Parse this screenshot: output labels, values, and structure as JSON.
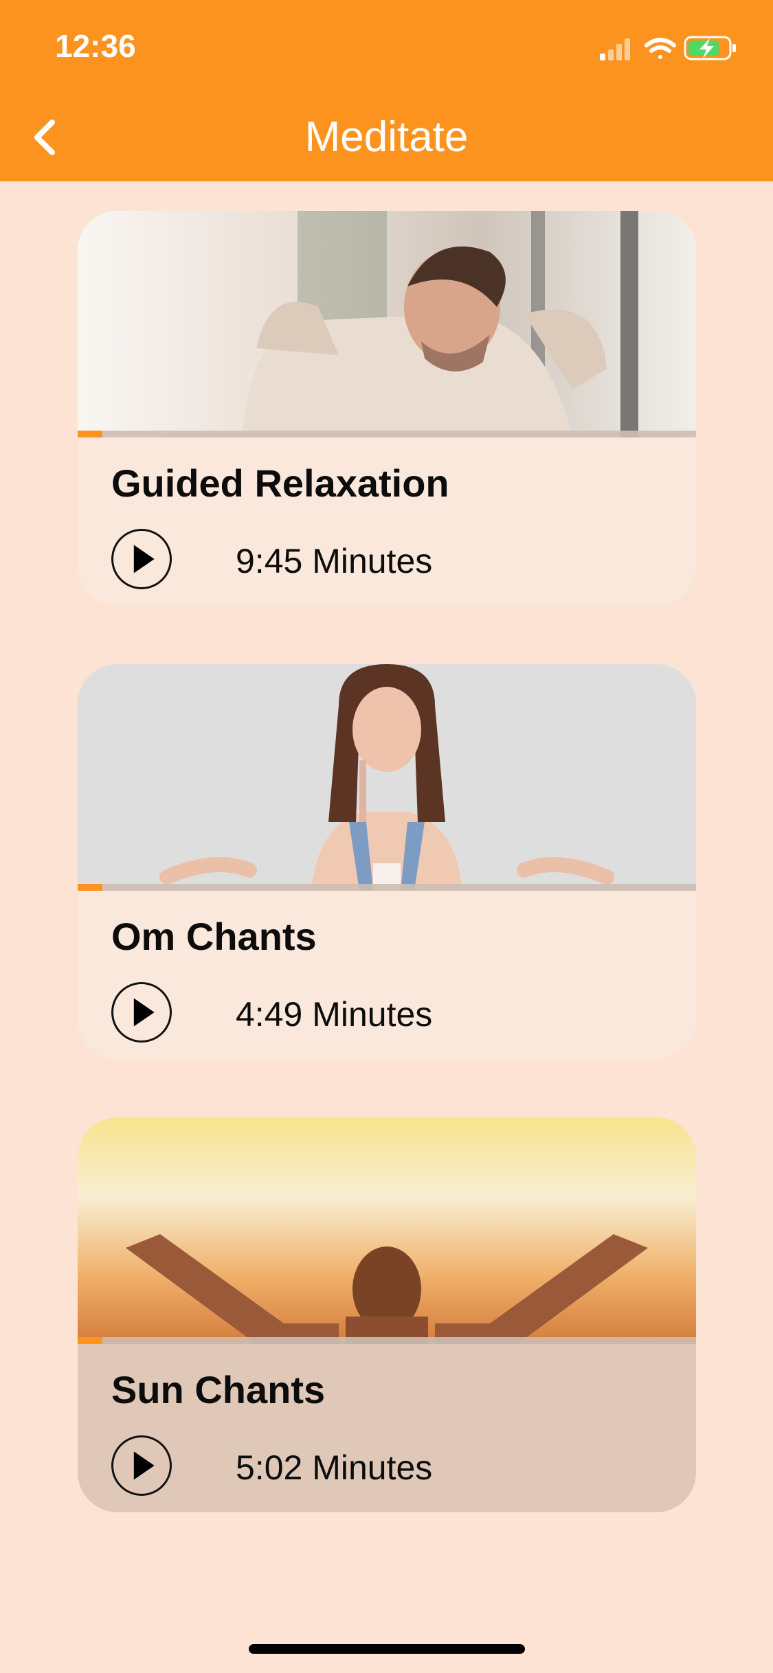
{
  "status_bar": {
    "time": "12:36",
    "icons": [
      "signal-icon",
      "wifi-icon",
      "battery-charging-icon"
    ]
  },
  "nav": {
    "title": "Meditate",
    "back_icon": "chevron-left-icon"
  },
  "colors": {
    "header": "#fd931f",
    "background": "#fde3d3",
    "progress": "#fd931f"
  },
  "cards": [
    {
      "title": "Guided Relaxation",
      "duration": "9:45 Minutes",
      "progress": 0.04,
      "image": "man-relaxing-photo"
    },
    {
      "title": "Om Chants",
      "duration": "4:49 Minutes",
      "progress": 0.04,
      "image": "woman-meditating-photo"
    },
    {
      "title": "Sun Chants",
      "duration": "5:02 Minutes",
      "progress": 0.04,
      "image": "woman-in-sunset-photo"
    }
  ]
}
